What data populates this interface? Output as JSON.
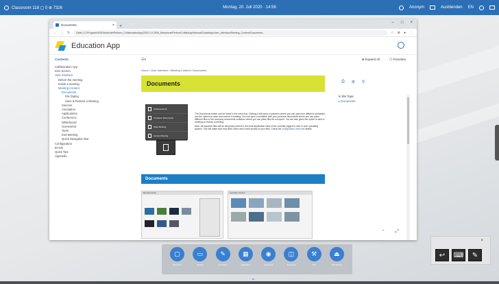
{
  "topbar": {
    "left_text": "Classroom 118 ▢ 0 ⊕ 7326",
    "center_text": "Montag, 20. Juli 2020 · 14:56",
    "right_items": [
      "Anonym",
      "Ausblenden",
      "EN"
    ]
  },
  "browser": {
    "tab_title": "Documents",
    "url": "Datei | C:/Program%20Files/smartPerform_CollaborationApp/2020.2.0.2005_Beta/smartPerformCollabApp/Manual/CollabApp/User_Interface/Meeting_Content/Documents..."
  },
  "app": {
    "title": "Education App"
  },
  "sidebar": {
    "header": "Contents",
    "items": [
      {
        "label": "Collaboration App",
        "indent": 0
      },
      {
        "label": "Intro Screen",
        "indent": 0
      },
      {
        "label": "User Interface",
        "indent": 0,
        "selected": true
      },
      {
        "label": "Before the meeting",
        "indent": 1
      },
      {
        "label": "Inside a meeting",
        "indent": 1
      },
      {
        "label": "Meeting Content",
        "indent": 1,
        "selected": true
      },
      {
        "label": "Documents",
        "indent": 2,
        "selected": true
      },
      {
        "label": "File Dialog",
        "indent": 3
      },
      {
        "label": "Save & Restore a Meeting",
        "indent": 3
      },
      {
        "label": "Sources",
        "indent": 2
      },
      {
        "label": "Annotation",
        "indent": 2
      },
      {
        "label": "Applications",
        "indent": 2
      },
      {
        "label": "Conference",
        "indent": 2
      },
      {
        "label": "Whiteboard",
        "indent": 2
      },
      {
        "label": "Screenshot",
        "indent": 2
      },
      {
        "label": "Tools",
        "indent": 2
      },
      {
        "label": "End Meeting",
        "indent": 2
      },
      {
        "label": "Quick Navigation Bar",
        "indent": 2
      },
      {
        "label": "Configuration",
        "indent": 0
      },
      {
        "label": "BYOD",
        "indent": 0
      },
      {
        "label": "Quick Tips",
        "indent": 0
      },
      {
        "label": "Appendix",
        "indent": 0
      }
    ]
  },
  "main": {
    "expand_all": "Expand All",
    "favorites": "Favorites",
    "breadcrumb": "Home / User Interface / Meeting Content / Documents",
    "page_title": "Documents",
    "in_this_topic": "In this Topic",
    "in_this_topic_link": "Documents",
    "menu_items": [
      "All Documents",
      "Container Documents",
      "Save Meeting",
      "Access Meeting"
    ],
    "body_p1": "The Documents button can be found in the menu bar. Clicking it will open a submenu where you can open four different containers and the options to save and restore a meeting. You can open a container with your personal documents where you can place different files or the company documents container where you can place files for everyone. You are also given the option to save a meeting or restore a meeting.",
    "body_p2_prefix": "Note: All imported files will be temporary stored in the local Application Data of the currently logged in user in your operating system. This will make sure that other users won't have access to your files. Check the",
    "body_p2_link": "configuration menu",
    "body_p2_suffix": "for details.",
    "section_title": "Documents",
    "shot1_title": "My Documents",
    "shot2_title": "Company Content"
  },
  "dock": {
    "buttons": [
      {
        "icon": "▢",
        "label": "Documents"
      },
      {
        "icon": "▭",
        "label": "Sources"
      },
      {
        "icon": "✎",
        "label": "Annotation"
      },
      {
        "icon": "▦",
        "label": "Applications"
      },
      {
        "icon": "◉",
        "label": "Conference"
      },
      {
        "icon": "◫",
        "label": "Screenshot"
      },
      {
        "icon": "⚒",
        "label": "Tools"
      },
      {
        "icon": "⏏",
        "label": "End Meeting"
      }
    ]
  },
  "colors": {
    "topbar": "#2c6fb5",
    "banner": "#d7e235",
    "section": "#1d7fc4",
    "dock_button": "#3a7fd0"
  }
}
